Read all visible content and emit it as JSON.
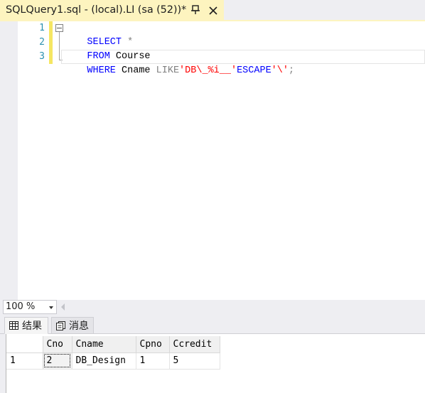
{
  "document_tab": {
    "title": "SQLQuery1.sql - (local).LI (sa (52))*",
    "pin_icon": "pin-icon",
    "close_icon": "close-icon"
  },
  "editor": {
    "line_numbers": [
      "1",
      "2",
      "3"
    ],
    "lines": [
      {
        "tokens": [
          {
            "text": "SELECT",
            "type": "kw"
          },
          {
            "text": " ",
            "type": "id"
          },
          {
            "text": "*",
            "type": "op"
          }
        ]
      },
      {
        "tokens": [
          {
            "text": "FROM",
            "type": "kw"
          },
          {
            "text": " Course",
            "type": "id"
          }
        ]
      },
      {
        "tokens": [
          {
            "text": "WHERE",
            "type": "kw"
          },
          {
            "text": " Cname ",
            "type": "id"
          },
          {
            "text": "LIKE",
            "type": "op"
          },
          {
            "text": "'DB\\_%i__'",
            "type": "str"
          },
          {
            "text": "ESCAPE",
            "type": "kw"
          },
          {
            "text": "'\\'",
            "type": "str"
          },
          {
            "text": ";",
            "type": "op"
          }
        ]
      }
    ],
    "colors": {
      "keyword": "#0000ff",
      "operator": "#808080",
      "string": "#ff0000",
      "line_number": "#2b91af"
    }
  },
  "zoom": {
    "value": "100 %"
  },
  "results_tabs": {
    "results_label": "结果",
    "messages_label": "消息"
  },
  "grid": {
    "columns": [
      "Cno",
      "Cname",
      "Cpno",
      "Ccredit"
    ],
    "rows": [
      {
        "row_number": "1",
        "cells": [
          "2",
          "DB_Design",
          "1",
          "5"
        ]
      }
    ]
  }
}
